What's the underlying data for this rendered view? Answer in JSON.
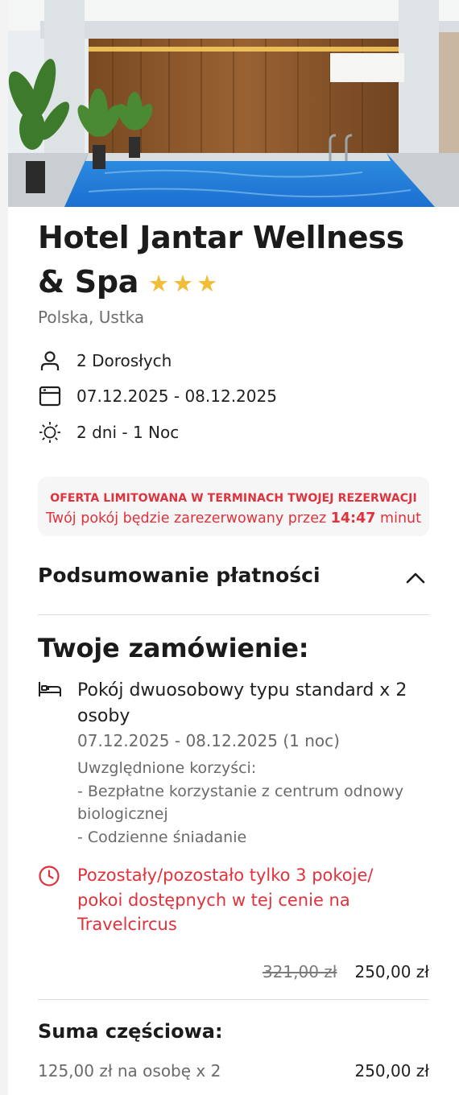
{
  "hotel": {
    "name": "Hotel Jantar Wellness & Spa",
    "stars": 3,
    "star_glyph": "★",
    "location": "Polska, Ustka",
    "image_icon": "indoor-pool-photo"
  },
  "booking": {
    "guests": "2 Dorosłych",
    "dates": "07.12.2025 - 08.12.2025",
    "duration": "2 dni - 1 Noc",
    "icons": [
      "person-icon",
      "calendar-icon",
      "sun-icon"
    ]
  },
  "offer": {
    "headline": "OFERTA LIMITOWANA W TERMINACH TWOJEJ REZERWACJI",
    "text_before": "Twój pokój będzie zarezerwowany przez ",
    "countdown": "14:47",
    "text_after": " minut",
    "color": "#e0323c"
  },
  "summary": {
    "title": "Podsumowanie płatności",
    "toggle_icon": "chevron-up-icon",
    "order_title": "Twoje zamówienie:",
    "room_name": "Pokój dwuosobowy typu standard x 2 osoby",
    "room_dates": "07.12.2025 - 08.12.2025 (1 noc)",
    "benefits_label": "Uwzględnione korzyści:",
    "benefits": [
      "- Bezpłatne korzystanie z centrum odnowy biologicznej",
      "- Codzienne śniadanie"
    ],
    "availability": "Pozostały/pozostało tylko 3 pokoje/ pokoi dostępnych w tej cenie na Travelcircus",
    "old_price": "321,00 zł",
    "price": "250,00 zł",
    "subtotal_title": "Suma częściowa:",
    "per_person": "125,00 zł na osobę x 2",
    "subtotal": "250,00 zł"
  },
  "colors": {
    "accent_red": "#e0323c",
    "star_yellow": "#efbd36"
  }
}
